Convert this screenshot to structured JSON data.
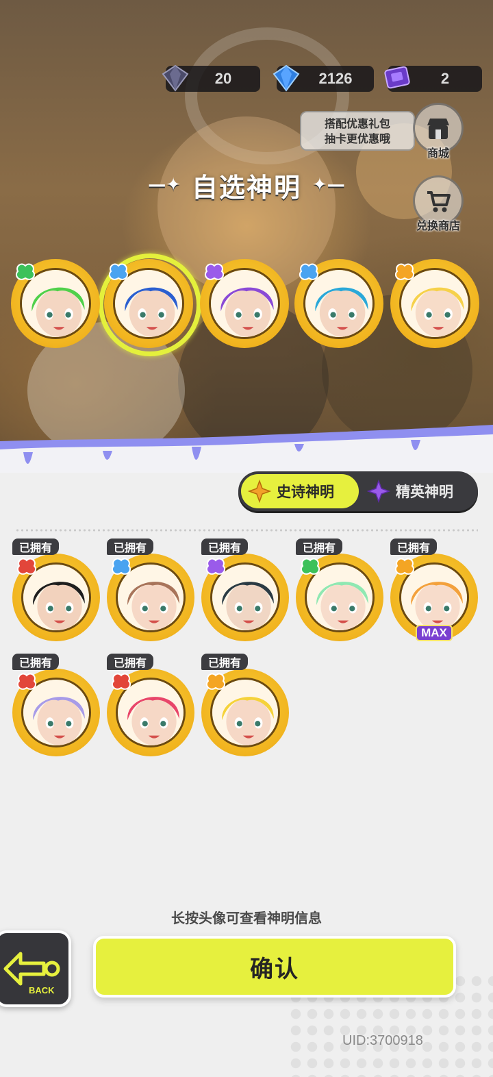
{
  "currency": [
    {
      "icon": "dark-diamond-icon",
      "value": "20"
    },
    {
      "icon": "blue-diamond-icon",
      "value": "2126"
    },
    {
      "icon": "purple-ticket-icon",
      "value": "2"
    }
  ],
  "promo": {
    "line1": "搭配优惠礼包",
    "line2": "抽卡更优惠哦"
  },
  "shop": {
    "label": "商城",
    "icon": "shop-icon"
  },
  "exchange": {
    "label": "兑换商店",
    "icon": "exchange-cart-icon"
  },
  "title": "自选神明",
  "featured": [
    {
      "name": "green-haired-god",
      "tag": "green",
      "selected": false
    },
    {
      "name": "blue-haired-god",
      "tag": "blue",
      "selected": true
    },
    {
      "name": "purple-haired-god",
      "tag": "purple",
      "selected": false
    },
    {
      "name": "teal-haired-god",
      "tag": "blue",
      "selected": false
    },
    {
      "name": "blonde-god",
      "tag": "orange",
      "selected": false
    }
  ],
  "tabs": {
    "epic": "史诗神明",
    "elite": "精英神明"
  },
  "owned_label": "已拥有",
  "max_label": "MAX",
  "owned": [
    {
      "name": "black-haired-god",
      "tag": "red",
      "max": false
    },
    {
      "name": "brown-haired-god",
      "tag": "blue",
      "max": false
    },
    {
      "name": "dark-teal-haired-god",
      "tag": "purple",
      "max": false
    },
    {
      "name": "mint-haired-god",
      "tag": "green",
      "max": false
    },
    {
      "name": "orange-haired-god",
      "tag": "orange",
      "max": true
    },
    {
      "name": "lavender-haired-god",
      "tag": "red",
      "max": false
    },
    {
      "name": "pink-cap-god",
      "tag": "red",
      "max": false
    },
    {
      "name": "yellow-helmet-god",
      "tag": "orange",
      "max": false
    }
  ],
  "hint": "长按头像可查看神明信息",
  "back_label": "BACK",
  "confirm": "确认",
  "uid": "UID:3700918",
  "colors": {
    "accent": "#e6f03e",
    "coin": "#f1b41f",
    "dark": "#3a3a3e",
    "tag_red": "#e2463a",
    "tag_blue": "#4aa3f0",
    "tag_purple": "#9a5bea",
    "tag_green": "#3cc15a",
    "tag_orange": "#f4a524"
  }
}
